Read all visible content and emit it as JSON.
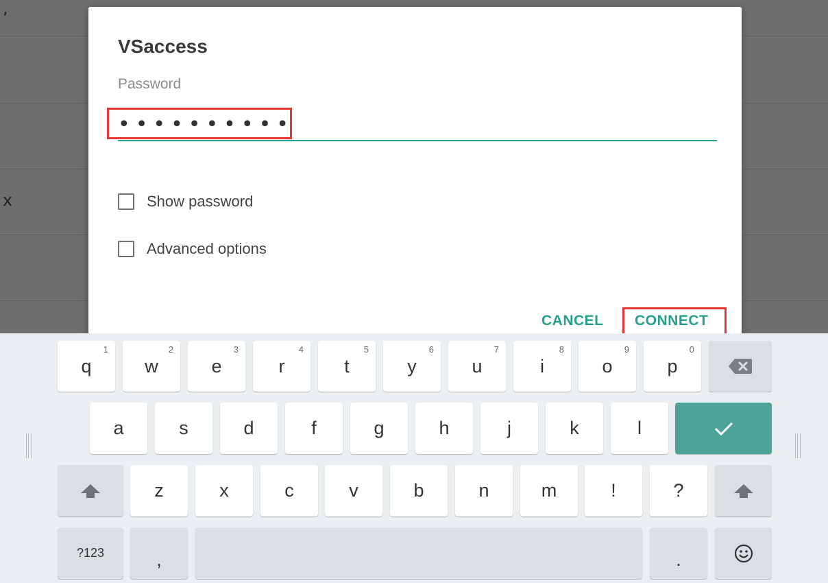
{
  "dialog": {
    "title": "VSaccess",
    "password_label": "Password",
    "password_value": "••••••••••",
    "show_password_label": "Show password",
    "advanced_options_label": "Advanced options",
    "cancel_label": "CANCEL",
    "connect_label": "CONNECT"
  },
  "background": {
    "glyph_top": ",",
    "glyph_mid": "x"
  },
  "keyboard": {
    "row1": [
      {
        "label": "q",
        "hint": "1"
      },
      {
        "label": "w",
        "hint": "2"
      },
      {
        "label": "e",
        "hint": "3"
      },
      {
        "label": "r",
        "hint": "4"
      },
      {
        "label": "t",
        "hint": "5"
      },
      {
        "label": "y",
        "hint": "6"
      },
      {
        "label": "u",
        "hint": "7"
      },
      {
        "label": "i",
        "hint": "8"
      },
      {
        "label": "o",
        "hint": "9"
      },
      {
        "label": "p",
        "hint": "0"
      }
    ],
    "row2": [
      "a",
      "s",
      "d",
      "f",
      "g",
      "h",
      "j",
      "k",
      "l"
    ],
    "row3": [
      "z",
      "x",
      "c",
      "v",
      "b",
      "n",
      "m",
      "!",
      "?"
    ],
    "symbols_label": "?123",
    "comma_label": ",",
    "period_label": ".",
    "icons": {
      "backspace": "backspace-icon",
      "enter": "checkmark-icon",
      "shift": "shift-icon",
      "emoji": "emoji-icon"
    },
    "accent_color": "#4ea398"
  },
  "colors": {
    "accent": "#24a08c",
    "highlight": "#e53935"
  }
}
